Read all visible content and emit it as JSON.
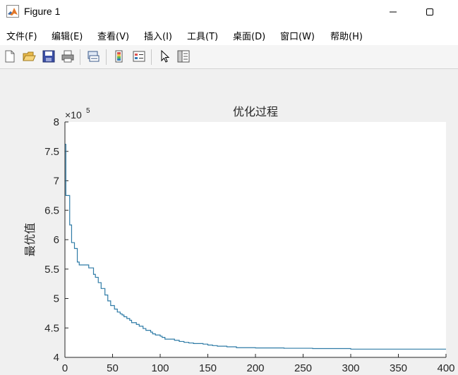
{
  "window": {
    "title": "Figure 1",
    "icon": "matlab-logo-icon",
    "controls": [
      "minimize-icon",
      "maximize-icon"
    ]
  },
  "menu": {
    "items": [
      "文件(F)",
      "编辑(E)",
      "查看(V)",
      "插入(I)",
      "工具(T)",
      "桌面(D)",
      "窗口(W)",
      "帮助(H)"
    ]
  },
  "toolbar": {
    "icons": [
      "new-figure-icon",
      "open-file-icon",
      "save-icon",
      "print-icon",
      "link-plot-icon",
      "insert-colorbar-icon",
      "insert-legend-icon",
      "edit-plot-pointer-icon",
      "property-inspector-icon"
    ]
  },
  "colors": {
    "series": "#2e7ba6",
    "axes_background": "#ffffff",
    "figure_background": "#f0f0f0"
  },
  "chart_data": {
    "type": "line",
    "title": "优化过程",
    "xlabel": "",
    "ylabel": "最优值",
    "exponent_label": "×10",
    "exponent_power": "5",
    "xlim": [
      0,
      400
    ],
    "ylim": [
      4,
      8
    ],
    "xticks": [
      "0",
      "50",
      "100",
      "150",
      "200",
      "250",
      "300",
      "350",
      "400"
    ],
    "yticks": [
      "4",
      "4.5",
      "5",
      "5.5",
      "6",
      "6.5",
      "7",
      "7.5",
      "8"
    ],
    "grid": false,
    "series": [
      {
        "x": [
          0,
          1,
          1,
          5,
          5,
          7,
          7,
          10,
          10,
          13,
          13,
          15,
          15,
          25,
          25,
          30,
          30,
          32,
          32,
          35,
          35,
          38,
          38,
          42,
          42,
          45,
          45,
          48,
          48,
          52,
          52,
          55,
          55,
          58,
          58,
          60,
          60,
          62,
          62,
          65,
          65,
          68,
          68,
          70,
          70,
          75,
          75,
          78,
          78,
          82,
          82,
          85,
          85,
          90,
          90,
          92,
          92,
          95,
          95,
          100,
          100,
          102,
          102,
          105,
          105,
          115,
          115,
          120,
          120,
          125,
          125,
          130,
          130,
          135,
          135,
          145,
          145,
          150,
          150,
          155,
          155,
          160,
          160,
          170,
          170,
          180,
          180,
          200,
          200,
          230,
          230,
          260,
          260,
          300,
          300,
          400
        ],
        "y": [
          7.62,
          7.62,
          6.75,
          6.75,
          6.25,
          6.25,
          5.95,
          5.95,
          5.85,
          5.85,
          5.62,
          5.62,
          5.57,
          5.57,
          5.52,
          5.52,
          5.41,
          5.41,
          5.36,
          5.36,
          5.27,
          5.27,
          5.17,
          5.17,
          5.06,
          5.06,
          4.96,
          4.96,
          4.88,
          4.88,
          4.82,
          4.82,
          4.77,
          4.77,
          4.74,
          4.74,
          4.72,
          4.72,
          4.69,
          4.69,
          4.66,
          4.66,
          4.63,
          4.63,
          4.59,
          4.59,
          4.56,
          4.56,
          4.53,
          4.53,
          4.49,
          4.49,
          4.46,
          4.46,
          4.43,
          4.43,
          4.4,
          4.4,
          4.38,
          4.38,
          4.36,
          4.36,
          4.34,
          4.34,
          4.31,
          4.31,
          4.29,
          4.29,
          4.27,
          4.27,
          4.255,
          4.255,
          4.245,
          4.245,
          4.235,
          4.235,
          4.225,
          4.225,
          4.21,
          4.21,
          4.2,
          4.2,
          4.19,
          4.19,
          4.18,
          4.18,
          4.165,
          4.165,
          4.16,
          4.16,
          4.155,
          4.155,
          4.15,
          4.15,
          4.14,
          4.14
        ]
      }
    ]
  }
}
